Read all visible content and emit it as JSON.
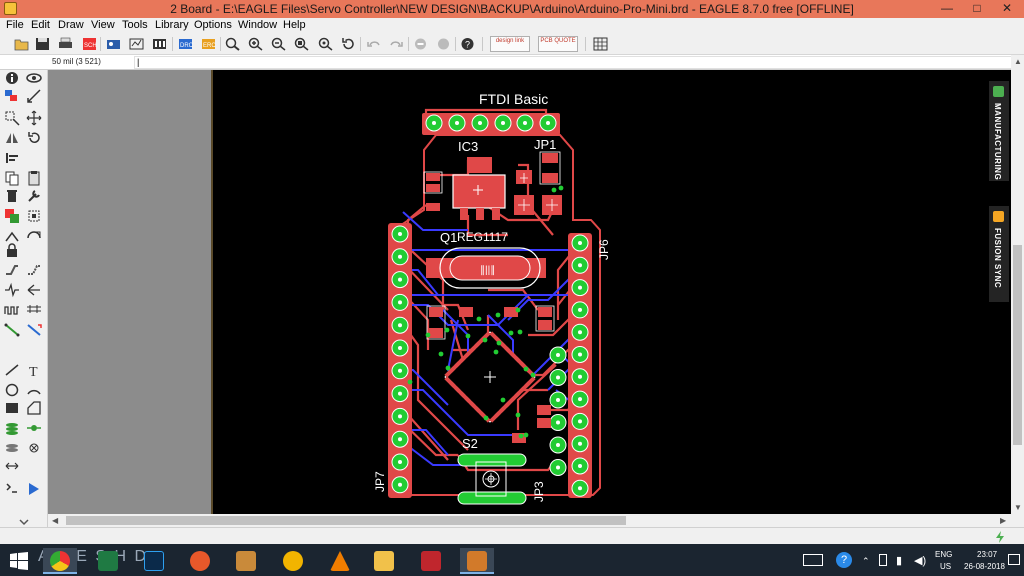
{
  "window": {
    "title": "2 Board - E:\\EAGLE Files\\Servo Controller\\NEW DESIGN\\BACKUP\\Arduino\\Arduino-Pro-Mini.brd - EAGLE 8.7.0 free [OFFLINE]",
    "controls": {
      "minimize": "—",
      "maximize": "□",
      "close": "✕"
    }
  },
  "menu": [
    "File",
    "Edit",
    "Draw",
    "View",
    "Tools",
    "Library",
    "Options",
    "Window",
    "Help"
  ],
  "toolbar": {
    "icons": [
      "open-icon",
      "save-icon",
      "print-icon",
      "cam-icon",
      "board-icon",
      "sch-icon",
      "layers-icon",
      "drc-icon",
      "erc-icon",
      "zoom-fit-icon",
      "zoom-in-icon",
      "zoom-out-icon",
      "zoom-select-icon",
      "zoom-redraw-icon",
      "undo-icon",
      "redo-icon",
      "stop-icon",
      "go-icon",
      "help-icon",
      "designlink-icon",
      "pcb-quote-icon",
      "grid-icon"
    ],
    "designlink_label": "design link",
    "pcb_quote_label": "PCB QUOTE"
  },
  "command_bar": {
    "coords": "50 mil (3 521)",
    "value": "|"
  },
  "side_panels": [
    {
      "label": "MANUFACTURING",
      "color": "#4caf50"
    },
    {
      "label": "FUSION SYNC",
      "color": "#f5a623"
    }
  ],
  "board": {
    "labels": {
      "ftdi": "FTDI Basic",
      "ic3": "IC3",
      "jp1": "JP1",
      "q1": "Q1",
      "reg": "REG1117",
      "jp6": "JP6",
      "jp7": "JP7",
      "s2": "S2",
      "jp3": "JP3",
      "crystal": "∥||∥"
    }
  },
  "taskbar": {
    "overlay_letters": "A N E S  H  D",
    "language": "ENG",
    "region": "US",
    "time": "23:07",
    "date": "26-08-2018"
  },
  "colors": {
    "titlebar": "#e8775a",
    "top_layer": "#e04848",
    "bottom_layer": "#3a3aff",
    "pad": "#22cc33",
    "canvas": "#000000"
  }
}
